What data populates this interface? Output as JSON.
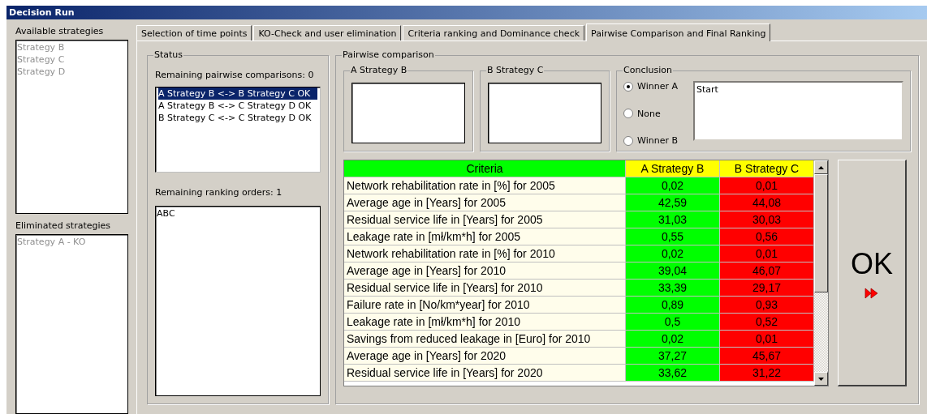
{
  "window": {
    "title": "Decision Run"
  },
  "available": {
    "label": "Available strategies",
    "items": [
      {
        "label": "Strategy B",
        "disabled": true
      },
      {
        "label": "Strategy C",
        "disabled": true
      },
      {
        "label": "Strategy D",
        "disabled": true
      }
    ]
  },
  "eliminated": {
    "label": "Eliminated strategies",
    "items": [
      {
        "label": "Strategy A - KO",
        "disabled": true
      }
    ]
  },
  "tabs": [
    {
      "label": "Selection of time points",
      "selected": false
    },
    {
      "label": "KO-Check and user elimination",
      "selected": false
    },
    {
      "label": "Criteria ranking and Dominance check",
      "selected": false
    },
    {
      "label": "Pairwise Comparison and Final Ranking",
      "selected": true
    }
  ],
  "status": {
    "title": "Status",
    "remaining_comparisons": "Remaining pairwise comparisons: 0",
    "comparisons": [
      {
        "label": "A Strategy B <-> B Strategy C OK",
        "selected": true
      },
      {
        "label": "A Strategy B <-> C Strategy D OK",
        "selected": false
      },
      {
        "label": "B Strategy C <-> C Strategy D OK",
        "selected": false
      }
    ],
    "remaining_orders": "Remaining ranking orders: 1",
    "orders": [
      "ABC"
    ]
  },
  "pairwise": {
    "title": "Pairwise comparison",
    "a_title": "A Strategy B",
    "b_title": "B Strategy C",
    "conclusion": {
      "title": "Conclusion",
      "options": [
        {
          "label": "Winner A",
          "selected": true
        },
        {
          "label": "None",
          "selected": false
        },
        {
          "label": "Winner B",
          "selected": false
        }
      ],
      "note": "Start"
    },
    "table": {
      "columns": [
        {
          "label": "Criteria",
          "color": "#00ff00"
        },
        {
          "label": "A Strategy B",
          "color": "#ffff00"
        },
        {
          "label": "B Strategy C",
          "color": "#ffff00"
        }
      ],
      "rows": [
        {
          "criterion": "Network rehabilitation rate in [%] for 2005",
          "values": [
            {
              "text": "0,02",
              "color": "#00ff00"
            },
            {
              "text": "0,01",
              "color": "#ff0000"
            }
          ]
        },
        {
          "criterion": "Average age in [Years] for 2005",
          "values": [
            {
              "text": "42,59",
              "color": "#00ff00"
            },
            {
              "text": "44,08",
              "color": "#ff0000"
            }
          ]
        },
        {
          "criterion": "Residual service life in [Years] for 2005",
          "values": [
            {
              "text": "31,03",
              "color": "#00ff00"
            },
            {
              "text": "30,03",
              "color": "#ff0000"
            }
          ]
        },
        {
          "criterion": "Leakage rate in [mł/km*h] for 2005",
          "values": [
            {
              "text": "0,55",
              "color": "#00ff00"
            },
            {
              "text": "0,56",
              "color": "#ff0000"
            }
          ]
        },
        {
          "criterion": "Network rehabilitation rate in [%] for 2010",
          "values": [
            {
              "text": "0,02",
              "color": "#00ff00"
            },
            {
              "text": "0,01",
              "color": "#ff0000"
            }
          ]
        },
        {
          "criterion": "Average age in [Years] for 2010",
          "values": [
            {
              "text": "39,04",
              "color": "#00ff00"
            },
            {
              "text": "46,07",
              "color": "#ff0000"
            }
          ]
        },
        {
          "criterion": "Residual service life in [Years] for 2010",
          "values": [
            {
              "text": "33,39",
              "color": "#00ff00"
            },
            {
              "text": "29,17",
              "color": "#ff0000"
            }
          ]
        },
        {
          "criterion": "Failure rate in [No/km*year] for 2010",
          "values": [
            {
              "text": "0,89",
              "color": "#00ff00"
            },
            {
              "text": "0,93",
              "color": "#ff0000"
            }
          ]
        },
        {
          "criterion": "Leakage rate in [mł/km*h] for 2010",
          "values": [
            {
              "text": "0,5",
              "color": "#00ff00"
            },
            {
              "text": "0,52",
              "color": "#ff0000"
            }
          ]
        },
        {
          "criterion": "Savings from reduced leakage in [Euro] for 2010",
          "values": [
            {
              "text": "0,02",
              "color": "#00ff00"
            },
            {
              "text": "0,01",
              "color": "#ff0000"
            }
          ]
        },
        {
          "criterion": "Average age in [Years] for 2020",
          "values": [
            {
              "text": "37,27",
              "color": "#00ff00"
            },
            {
              "text": "45,67",
              "color": "#ff0000"
            }
          ]
        },
        {
          "criterion": "Residual service life in [Years] for 2020",
          "values": [
            {
              "text": "33,62",
              "color": "#00ff00"
            },
            {
              "text": "31,22",
              "color": "#ff0000"
            }
          ]
        }
      ]
    },
    "ok_button": "OK"
  }
}
